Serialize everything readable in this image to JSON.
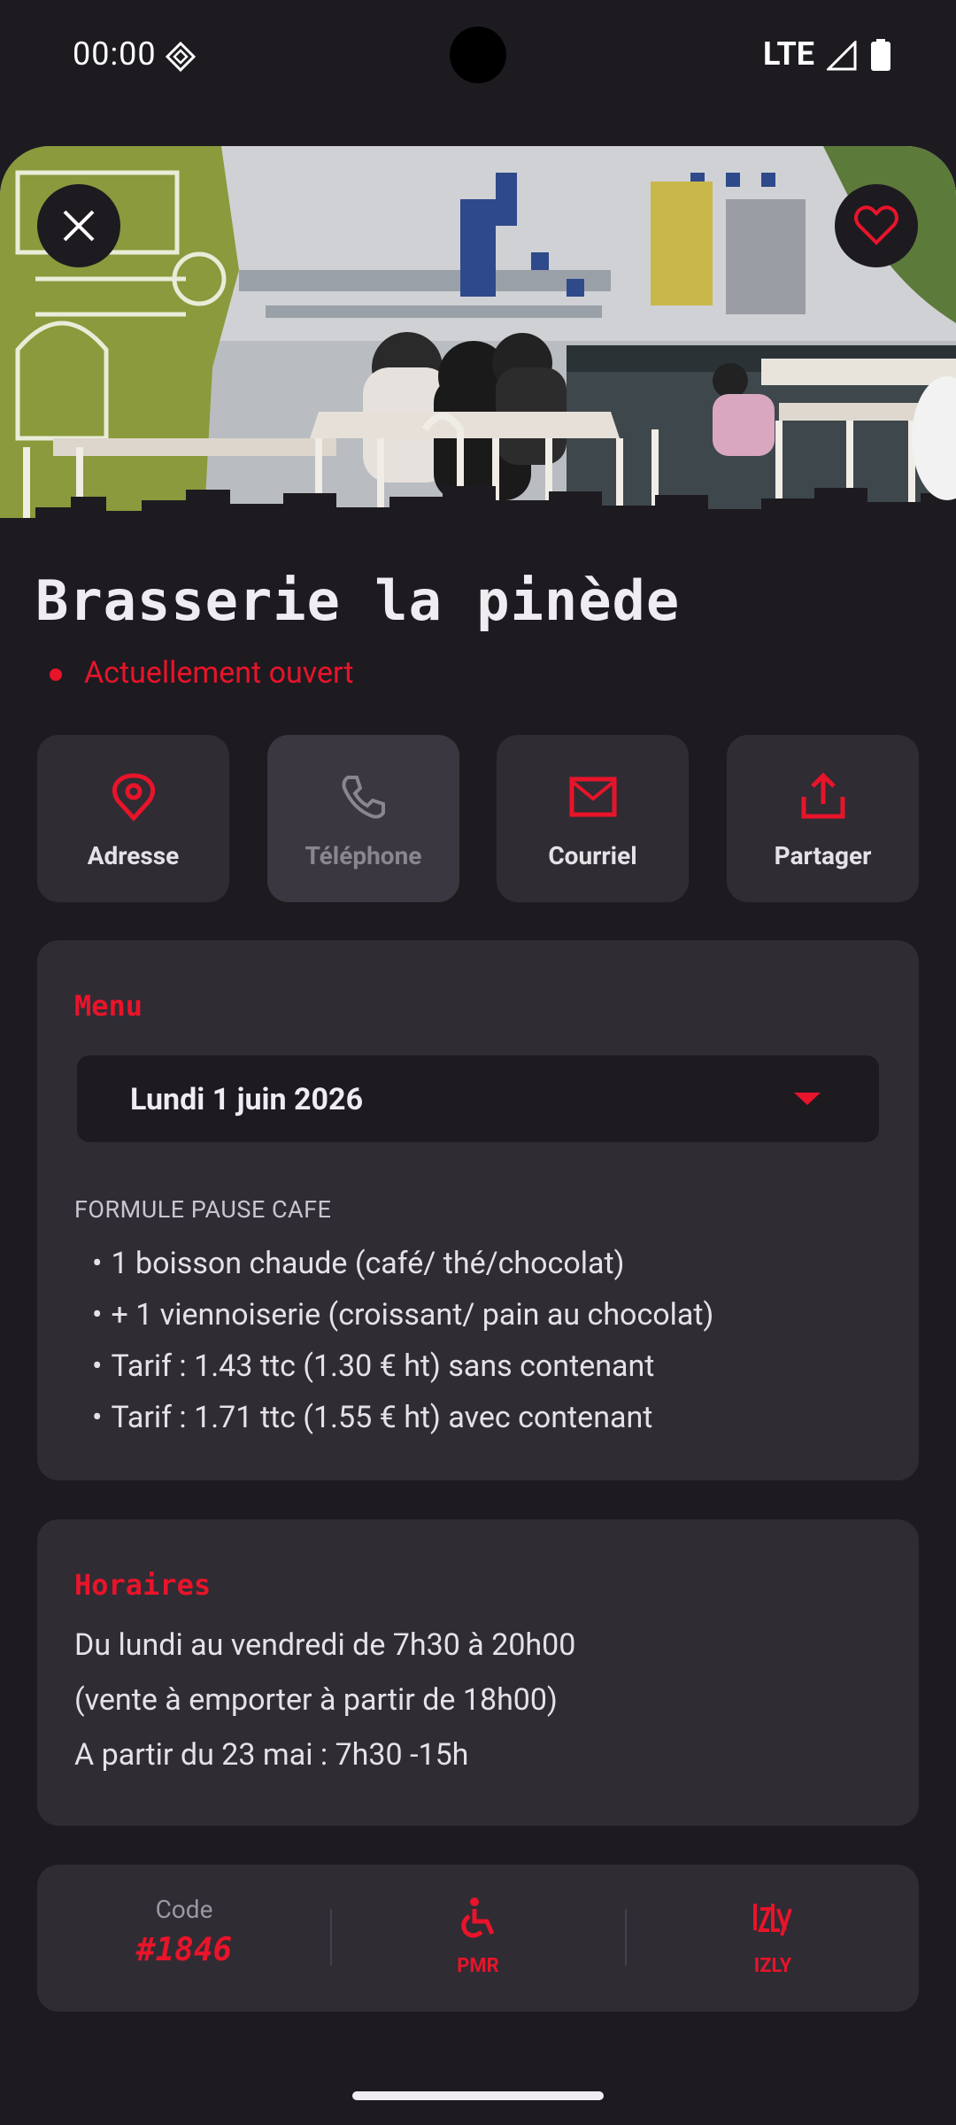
{
  "status": {
    "time": "00:00",
    "network": "LTE"
  },
  "restaurant": {
    "name": "Brasserie la pinède",
    "open_status": "Actuellement ouvert"
  },
  "actions": [
    {
      "label": "Adresse",
      "icon": "location-pin-icon",
      "enabled": true
    },
    {
      "label": "Téléphone",
      "icon": "phone-icon",
      "enabled": false
    },
    {
      "label": "Courriel",
      "icon": "mail-icon",
      "enabled": true
    },
    {
      "label": "Partager",
      "icon": "share-icon",
      "enabled": true
    }
  ],
  "menu": {
    "title": "Menu",
    "selected_date": "Lundi 1 juin 2026",
    "formula_title": "FORMULE PAUSE CAFE",
    "items": [
      "1 boisson chaude (café/ thé/chocolat)",
      "+ 1 viennoiserie (croissant/ pain au chocolat)",
      "Tarif : 1.43 ttc (1.30 € ht) sans contenant",
      "Tarif : 1.71 ttc (1.55 € ht) avec contenant"
    ]
  },
  "hours": {
    "title": "Horaires",
    "lines": [
      "Du lundi au vendredi de 7h30 à 20h00",
      "(vente à emporter à partir de 18h00)",
      "A partir du 23 mai : 7h30 -15h"
    ]
  },
  "info": {
    "code_label": "Code",
    "code_value": "#1846",
    "pmr_label": "PMR",
    "izly_label": "IZLY"
  },
  "colors": {
    "accent": "#e8142a",
    "background": "#1d1b20",
    "card": "#2f2c34"
  }
}
